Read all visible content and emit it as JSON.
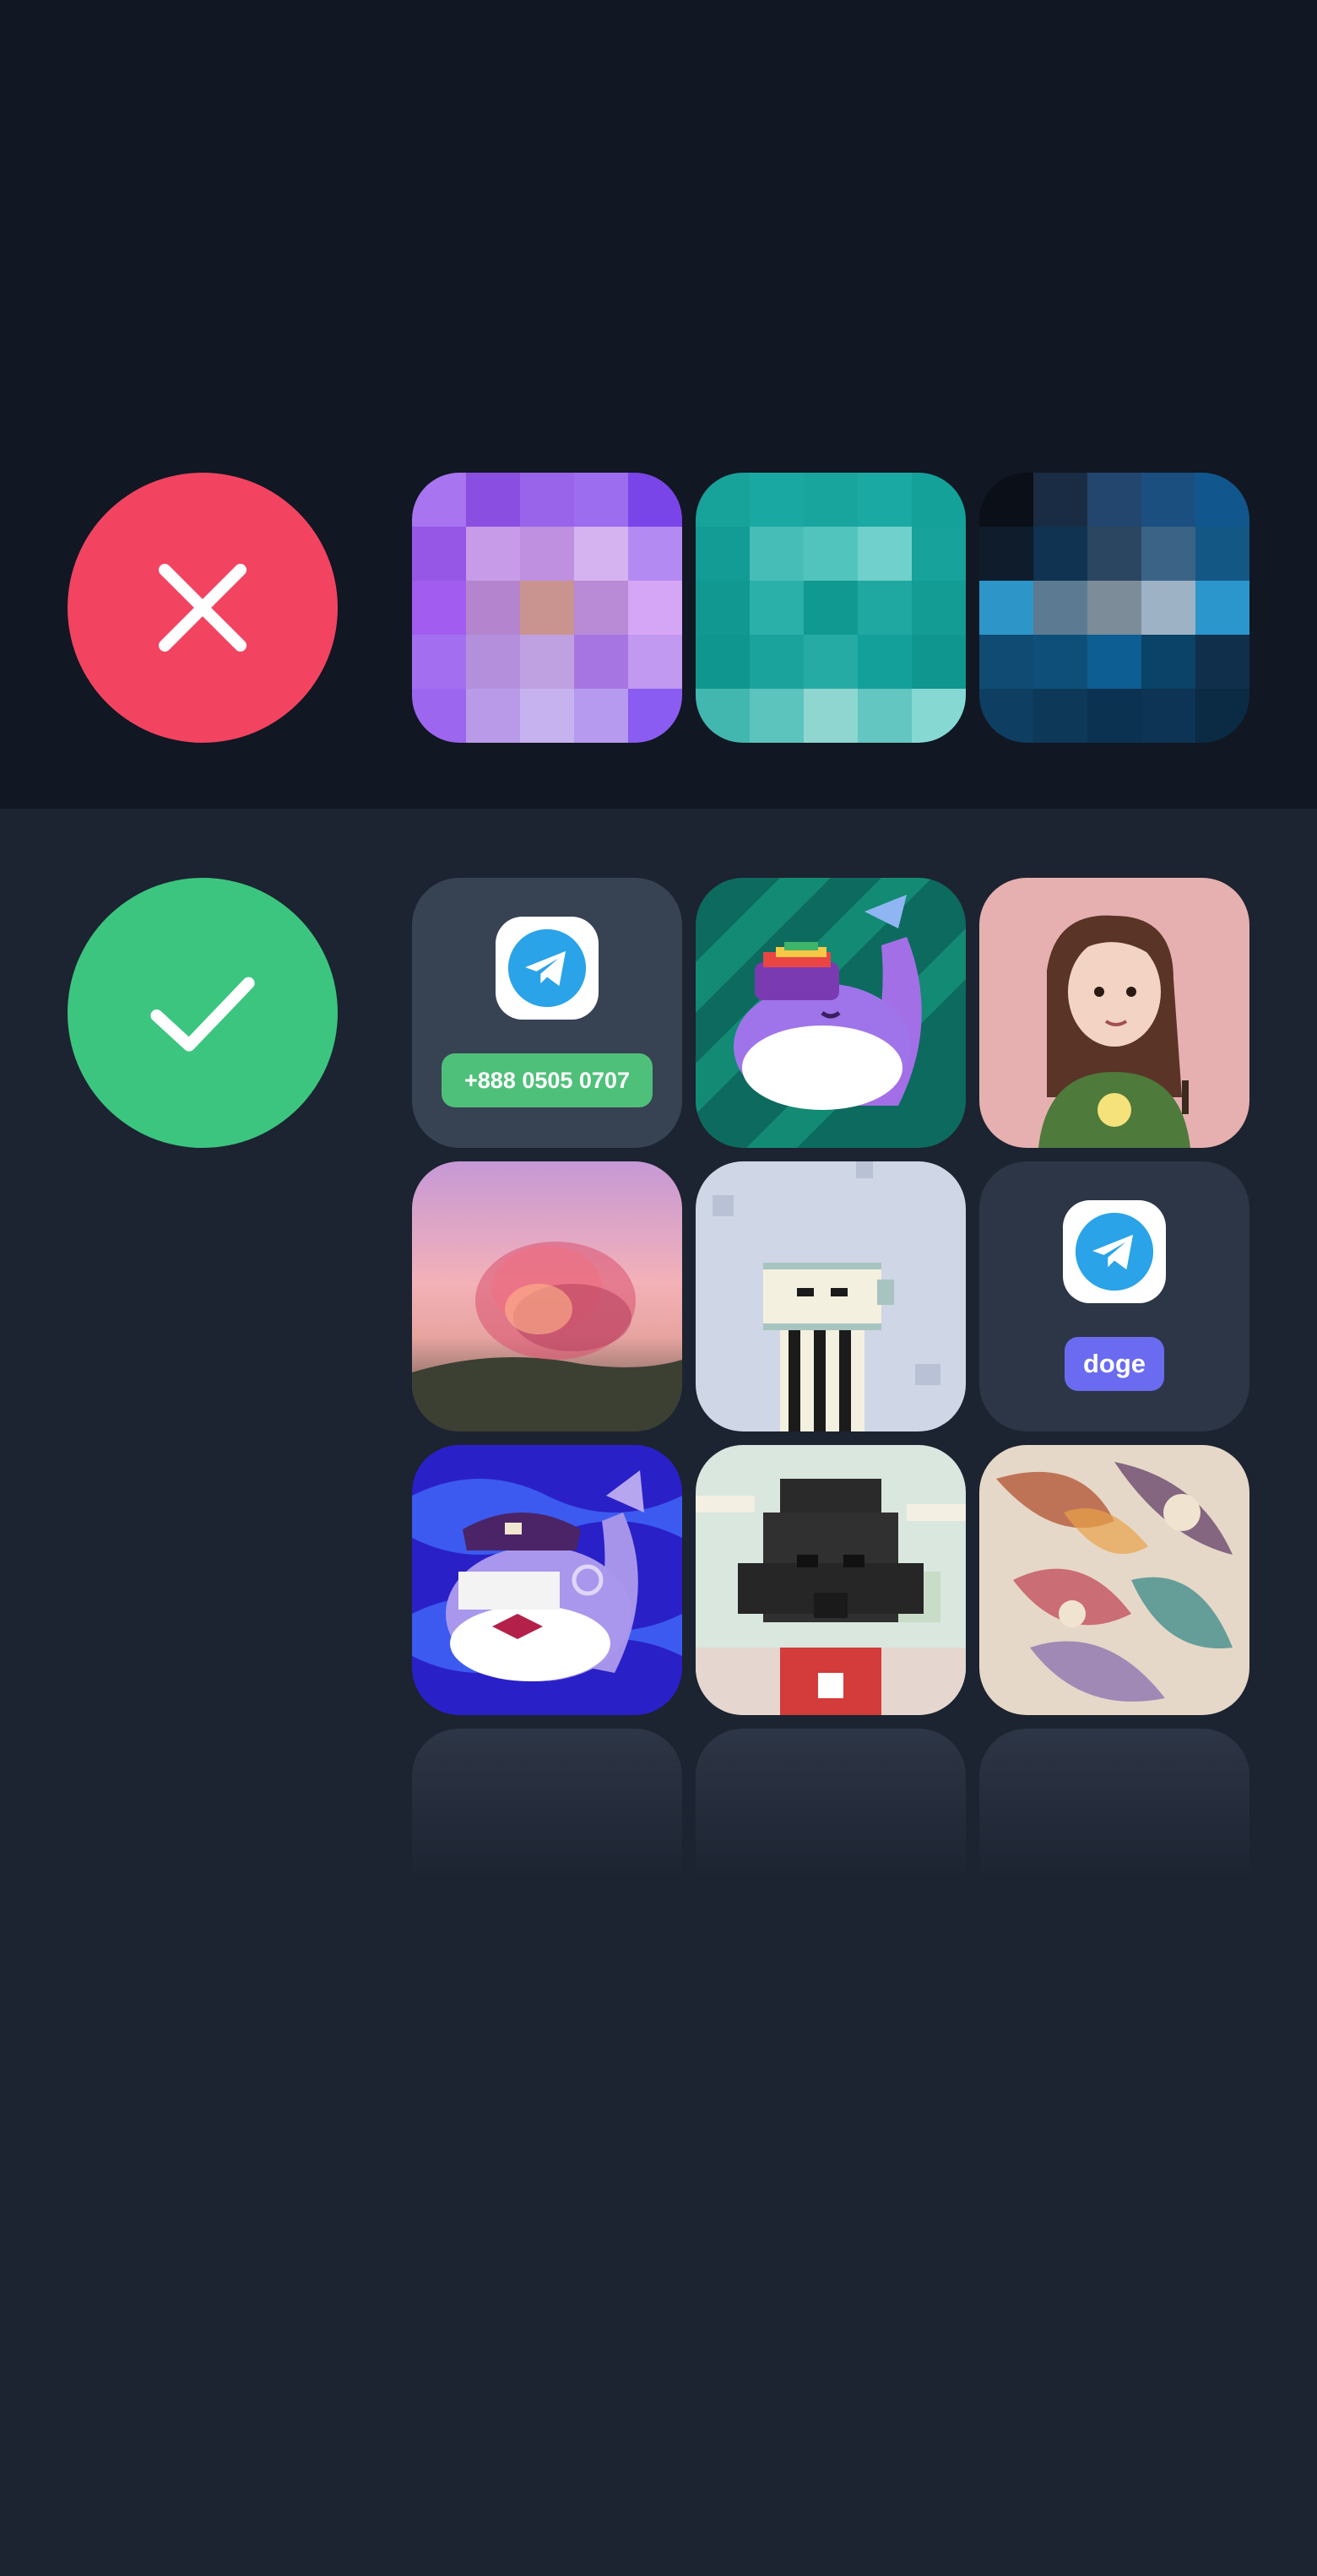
{
  "rejected": {
    "status_icon": "cross-icon",
    "color": "#f24461",
    "tiles": [
      "pixelated-purple-avatar",
      "pixelated-teal-avatar",
      "pixelated-blue-avatar"
    ]
  },
  "accepted": {
    "status_icon": "check-icon",
    "color": "#3cc57f",
    "tiles": [
      {
        "kind": "telegram-number",
        "label": "+888 0505 0707"
      },
      {
        "kind": "image",
        "name": "whale-with-rainbow-cap"
      },
      {
        "kind": "image",
        "name": "girl-with-brown-hair"
      },
      {
        "kind": "image",
        "name": "translucent-rose"
      },
      {
        "kind": "image",
        "name": "pixel-character-with-speech"
      },
      {
        "kind": "telegram-username",
        "label": "doge"
      },
      {
        "kind": "image",
        "name": "whale-pirate-with-monocle"
      },
      {
        "kind": "image",
        "name": "pixel-helmet-character"
      },
      {
        "kind": "image",
        "name": "abstract-painting"
      }
    ]
  },
  "colors": {
    "top_background": "#111723",
    "bottom_background": "#1c2331",
    "telegram_blue": "#2aa3e8",
    "number_chip": "#4fc07a",
    "username_chip": "#6a6bf0"
  }
}
